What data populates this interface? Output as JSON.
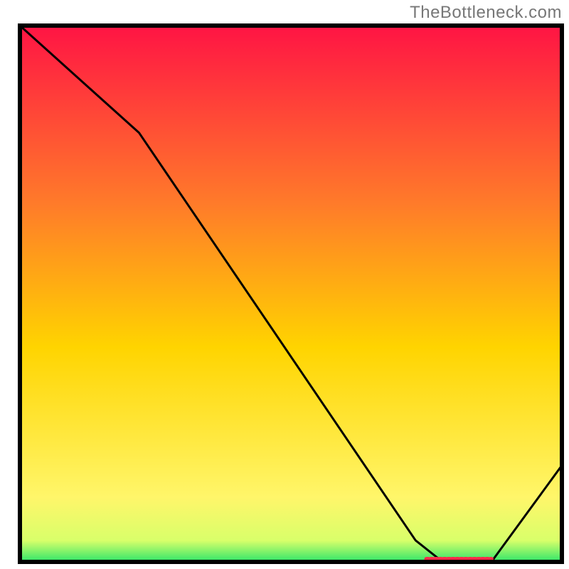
{
  "attribution": "TheBottleneck.com",
  "chart_data": {
    "type": "line",
    "title": "",
    "xlabel": "",
    "ylabel": "",
    "xlim": [
      0,
      100
    ],
    "ylim": [
      0,
      100
    ],
    "x": [
      0,
      22,
      73,
      78,
      87,
      100
    ],
    "values": [
      100,
      80,
      4,
      0,
      0,
      18
    ],
    "sweet_spot": {
      "x_start": 75,
      "x_end": 87,
      "y": 0
    },
    "gradient_stops": [
      {
        "offset": 0.0,
        "color": "#ff1444"
      },
      {
        "offset": 0.33,
        "color": "#ff7a2a"
      },
      {
        "offset": 0.6,
        "color": "#ffd400"
      },
      {
        "offset": 0.88,
        "color": "#fff66a"
      },
      {
        "offset": 0.96,
        "color": "#d9ff6a"
      },
      {
        "offset": 1.0,
        "color": "#2ee66a"
      }
    ],
    "frame": {
      "color": "#000000",
      "width": 6
    },
    "curve_style": {
      "color": "#000000",
      "width": 3
    },
    "sweet_spot_style": {
      "color": "#ff2b4a",
      "width": 6
    }
  }
}
